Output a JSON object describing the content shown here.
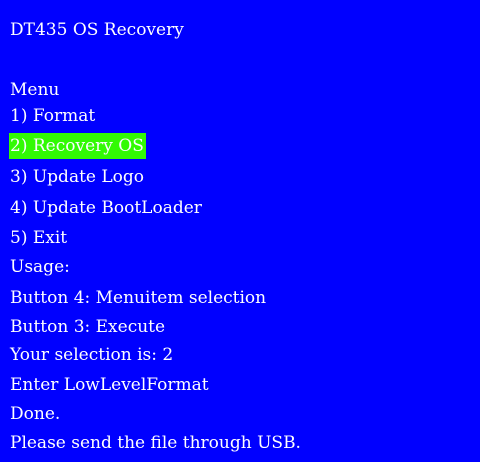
{
  "colors": {
    "background": "#0000ff",
    "text": "#ffffff",
    "highlight": "#33ff00",
    "outer_border": "#ffffff"
  },
  "title": "DT435 OS Recovery",
  "menu": {
    "heading": "Menu",
    "items": [
      {
        "label": "1) Format",
        "selected": false
      },
      {
        "label": "2) Recovery OS",
        "selected": true
      },
      {
        "label": "3) Update Logo",
        "selected": false
      },
      {
        "label": "4) Update BootLoader",
        "selected": false
      },
      {
        "label": "5) Exit",
        "selected": false
      }
    ]
  },
  "usage": {
    "heading": "Usage:",
    "lines": [
      "Button 4: Menuitem selection",
      "Button 3: Execute"
    ]
  },
  "log": [
    "Your selection is: 2",
    "Enter LowLevelFormat",
    "Done.",
    "Please send the file through USB."
  ]
}
